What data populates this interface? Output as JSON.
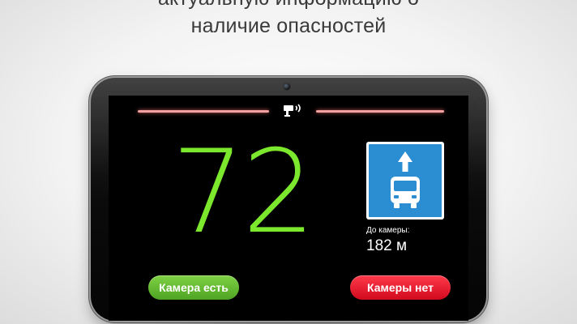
{
  "header": {
    "caption_top": "актуальную информацию о",
    "caption_main": "наличие опасностей"
  },
  "screen": {
    "speed": "72",
    "speed_color": "#7be82d",
    "alert_color": "#f3a0a0",
    "alert_icon": "speed-camera-icon",
    "sign": {
      "icon": "bus-lane-sign-icon",
      "background": "#2c8ed2"
    },
    "distance_label": "До камеры:",
    "distance_value": "182 м",
    "buttons": {
      "camera_yes": "Камера есть",
      "camera_no": "Камеры нет"
    }
  }
}
